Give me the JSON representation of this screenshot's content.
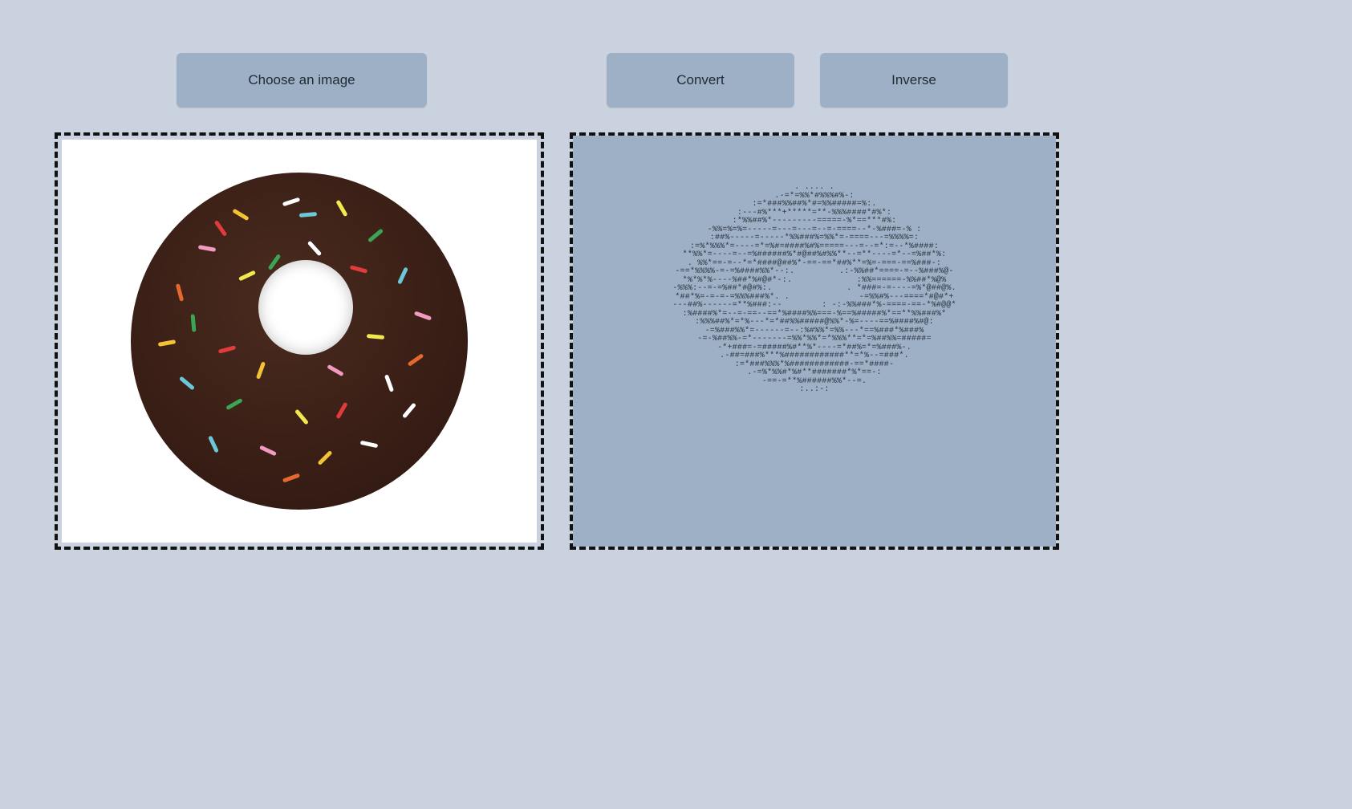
{
  "toolbar": {
    "choose_label": "Choose an image",
    "convert_label": "Convert",
    "inverse_label": "Inverse"
  },
  "preview": {
    "description": "chocolate-frosted donut with multicolor sprinkles"
  },
  "ascii_art": ". .... .\n.-=*=%%*#%%%#%-:\n:=*###%%##%*#=%%#####=%:.\n:---#%***+*****=**-%%%####*#%*:\n:*%%##%*---------=====-%*==***#%:\n-%%=%=%=-----=---=---=--=-====--*-%###=-% :\n:##%-----=-----*%%###%=%%*=-====---=%%%%=:\n:=%*%%%*=----=*=%#=####%#%=====---=--=*:=--*%####:\n**%%*=----=--=%######%*#@##%#%%**--=**----=*--=%##*%:\n. %%*==-=--*=*####@##%*-==-==*##%**=%=-===-==%###-:\n-==*%%%%-=-=%####%%*--:.         .:-%%##*====-=--%###%@-\n*%*%*%----%##*%#@#*-:.             :%%======-%%##*%@%\n-%%%:--=-=%##*#@#%:.               . *###=-=----=%*@##@%.\n*##*%=-=-=-=%%%###%*. .              -=%%#%---====*#@#*+\n---##%------=**%###:--        : -:-%%###*%-====-==-*%#@@*\n:%####%*=--=-==--==*%####%%===-%==%#####%*==**%%###%*\n:%%%##%*=*%---*=*##%%#####@%%*-%=----==%####%#@:\n-=%###%%*=------=--:%#%%*=%%---*==%###*%###%\n-=-%##%%-=*-------=%%*%%*=*%%%**=*=%##%%=#####=\n-*+###=-=#####%#**%*----=*##%=*=%###%-.\n.-##=###%***%############**=*%--=###*.\n:=*###%%%*%############-==*####-\n.-=%*%%#*%#**#######*%*==-:\n-==-=**%######%%*--=.\n:..:-:"
}
